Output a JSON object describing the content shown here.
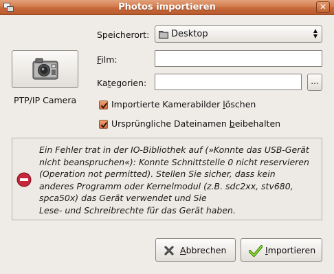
{
  "window": {
    "title": "Photos importieren",
    "close_label": "✕"
  },
  "device": {
    "label": "PTP/IP Camera"
  },
  "form": {
    "speicherort_label": "Speicherort:",
    "speicherort_value": "Desktop",
    "film_label_pre": "",
    "film_label_u": "F",
    "film_label_post": "ilm:",
    "film_value": "",
    "kategorien_label_pre": "Ka",
    "kategorien_label_u": "t",
    "kategorien_label_post": "egorien:",
    "kategorien_value": "",
    "browse_label": "..."
  },
  "options": {
    "delete_label_pre": "Importierte Kamerabilder ",
    "delete_label_u": "l",
    "delete_label_post": "öschen",
    "delete_checked": true,
    "keepnames_label_pre": "Ursprüngliche Dateinamen ",
    "keepnames_label_u": "b",
    "keepnames_label_post": "eibehalten",
    "keepnames_checked": true
  },
  "error": {
    "line1": "Ein Fehler trat in der IO-Bibliothek auf (»Konnte das USB-Gerät",
    "line2": "nicht beanspruchen«): Konnte Schnittstelle 0 nicht reservieren",
    "line3": "(Operation not permitted). Stellen Sie sicher, dass kein",
    "line4": "anderes Programm oder Kernelmodul (z.B. sdc2xx, stv680,",
    "line5": "spca50x) das Gerät verwendet und Sie",
    "line6": "Lese- und Schreibrechte für das Gerät haben."
  },
  "buttons": {
    "cancel_u": "A",
    "cancel_rest": "bbrechen",
    "import_u": "I",
    "import_rest": "mportieren"
  },
  "colors": {
    "titlebar": "#c8693a",
    "checkbox": "#d2693a",
    "error_icon": "#c4263a",
    "ok_check": "#4e9a06"
  },
  "icons": [
    "window-menu-icon",
    "close-icon",
    "camera-icon",
    "folder-icon",
    "dropdown-arrows-icon",
    "checkmark-icon",
    "error-icon",
    "cancel-x-icon",
    "ok-check-icon"
  ]
}
